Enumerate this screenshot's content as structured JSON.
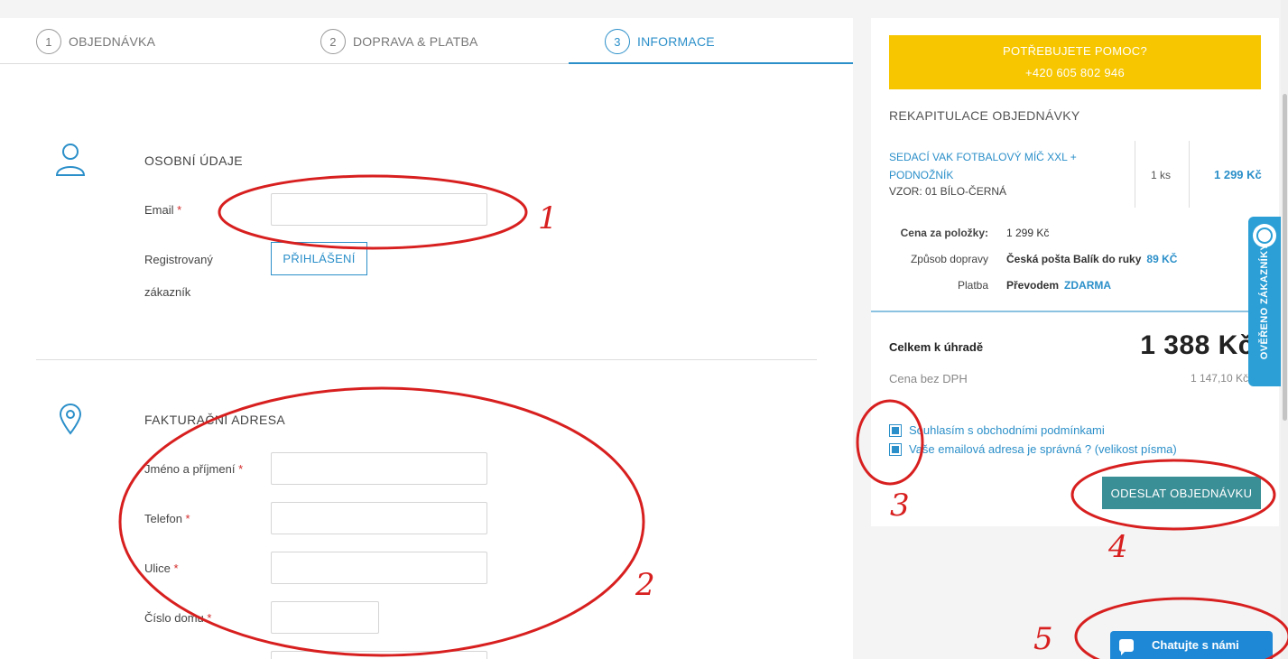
{
  "steps": [
    {
      "num": "1",
      "label": "OBJEDNÁVKA"
    },
    {
      "num": "2",
      "label": "DOPRAVA & PLATBA"
    },
    {
      "num": "3",
      "label": "INFORMACE"
    }
  ],
  "personal": {
    "title": "OSOBNÍ ÚDAJE",
    "email_label": "Email",
    "required_mark": "*",
    "registered_label_1": "Registrovaný",
    "registered_label_2": "zákazník",
    "login_button": "PŘIHLÁŠENÍ"
  },
  "billing": {
    "title": "FAKTURAČNÍ ADRESA",
    "fields": [
      "Jméno a příjmení",
      "Telefon",
      "Ulice",
      "Číslo domu"
    ]
  },
  "help": {
    "line1": "POTŘEBUJETE POMOC?",
    "line2": "+420 605 802 946"
  },
  "recap": {
    "title": "REKAPITULACE OBJEDNÁVKY",
    "product_name": "SEDACÍ VAK FOTBALOVÝ MÍČ XXL + PODNOŽNÍK",
    "product_variant": "VZOR: 01 BÍLO-ČERNÁ",
    "quantity": "1 ks",
    "product_price": "1 299 Kč",
    "items_label": "Cena za položky:",
    "items_value": "1 299 Kč",
    "shipping_label": "Způsob dopravy",
    "shipping_value": "Česká pošta Balík do ruky",
    "shipping_price": "89 KČ",
    "payment_label": "Platba",
    "payment_value": "Převodem",
    "payment_price": "ZDARMA",
    "total_label": "Celkem k úhradě",
    "total_value": "1 388 Kč",
    "no_vat_label": "Cena bez DPH",
    "no_vat_value": "1 147,10 Kč"
  },
  "checkboxes": [
    {
      "label": "Souhlasím s obchodními podmínkami",
      "checked": true
    },
    {
      "label": "Vaše emailová adresa je správná ? (velikost písma)",
      "checked": true
    }
  ],
  "submit_button": "ODESLAT OBJEDNÁVKU",
  "trust_badge": "OVĚŘENO ZÁKAZNÍKY",
  "chat_button": "Chatujte s námi",
  "annotations": [
    "1",
    "2",
    "3",
    "4",
    "5"
  ],
  "colors": {
    "accent": "#2b8fc9",
    "help_bg": "#f7c600",
    "submit_bg": "#3a8e96",
    "annotation": "#d81f1f",
    "required": "#d42b2b"
  }
}
